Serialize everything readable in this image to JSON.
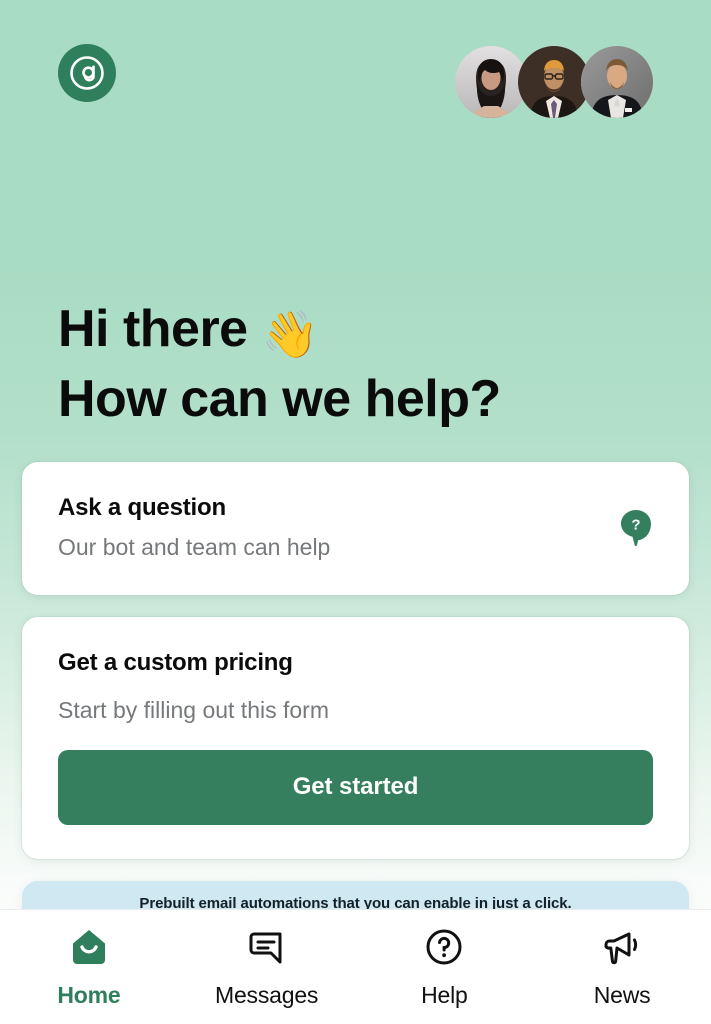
{
  "brand": {
    "logo_icon": "at-email-logo-icon",
    "accent_green": "#357f5f",
    "logo_green": "#2f7f5c",
    "background_mint": "#a9dcc4",
    "promo_blue": "#cfe8f1"
  },
  "header": {
    "team_avatars": [
      {
        "name": "avatar-team-member-1",
        "alt": "woman with long dark hair"
      },
      {
        "name": "avatar-team-member-2",
        "alt": "man with glasses in suit"
      },
      {
        "name": "avatar-team-member-3",
        "alt": "man in black suit and tie"
      }
    ]
  },
  "greeting": {
    "line1": "Hi there",
    "wave_emoji": "👋",
    "line2": "How can we help?"
  },
  "cards": [
    {
      "title": "Ask a question",
      "subtitle": "Our bot and team can help",
      "icon": "question-bubble-icon"
    },
    {
      "title": "Get a custom pricing",
      "subtitle": "Start by filling out this form",
      "button_label": "Get started"
    }
  ],
  "promo": {
    "text": "Prebuilt email automations that you can enable in just a click."
  },
  "nav": {
    "items": [
      {
        "label": "Home",
        "icon": "home-icon",
        "active": true
      },
      {
        "label": "Messages",
        "icon": "message-bubble-icon",
        "active": false
      },
      {
        "label": "Help",
        "icon": "question-circle-icon",
        "active": false
      },
      {
        "label": "News",
        "icon": "megaphone-icon",
        "active": false
      }
    ]
  }
}
